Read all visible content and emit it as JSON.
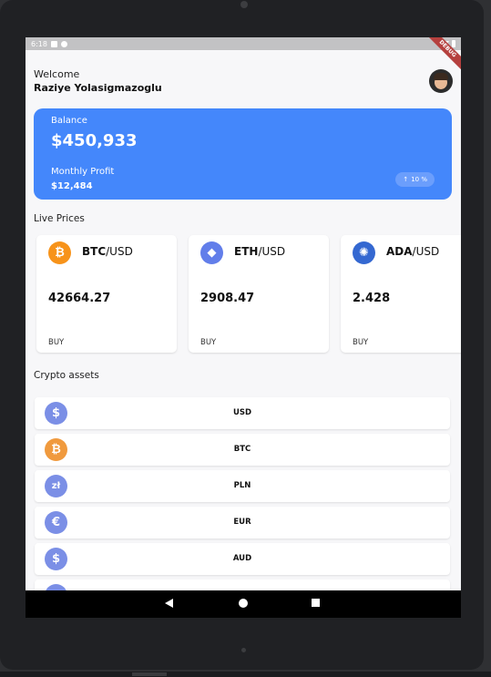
{
  "status_bar": {
    "time": "6:18"
  },
  "debug_banner": "DEBUG",
  "header": {
    "welcome": "Welcome",
    "user_name": "Raziye Yolasigmazoglu"
  },
  "balance_card": {
    "balance_label": "Balance",
    "balance_value": "$450,933",
    "profit_label": "Monthly Profit",
    "profit_value": "$12,484",
    "badge_arrow": "↑",
    "badge_text": "10 %"
  },
  "live_prices": {
    "title": "Live Prices",
    "cards": [
      {
        "symbol": "BTC",
        "quote": "/USD",
        "price": "42664.27",
        "buy": "BUY",
        "icon": "bitcoin-icon",
        "glyph": "₿",
        "color": "#f7931a"
      },
      {
        "symbol": "ETH",
        "quote": "/USD",
        "price": "2908.47",
        "buy": "BUY",
        "icon": "ethereum-icon",
        "glyph": "◆",
        "color": "#627eea"
      },
      {
        "symbol": "ADA",
        "quote": "/USD",
        "price": "2.428",
        "buy": "BUY",
        "icon": "cardano-icon",
        "glyph": "✺",
        "color": "#3468d1"
      }
    ]
  },
  "crypto_assets": {
    "title": "Crypto assets",
    "items": [
      {
        "label": "USD",
        "icon": "dollar-icon",
        "glyph": "$",
        "color": "#7b8fe6"
      },
      {
        "label": "BTC",
        "icon": "bitcoin-icon",
        "glyph": "₿",
        "color": "#f09a3e"
      },
      {
        "label": "PLN",
        "icon": "zloty-icon",
        "glyph": "zł",
        "color": "#7b8fe6"
      },
      {
        "label": "EUR",
        "icon": "euro-icon",
        "glyph": "€",
        "color": "#7b8fe6"
      },
      {
        "label": "AUD",
        "icon": "dollar-icon",
        "glyph": "$",
        "color": "#7b8fe6"
      }
    ]
  }
}
